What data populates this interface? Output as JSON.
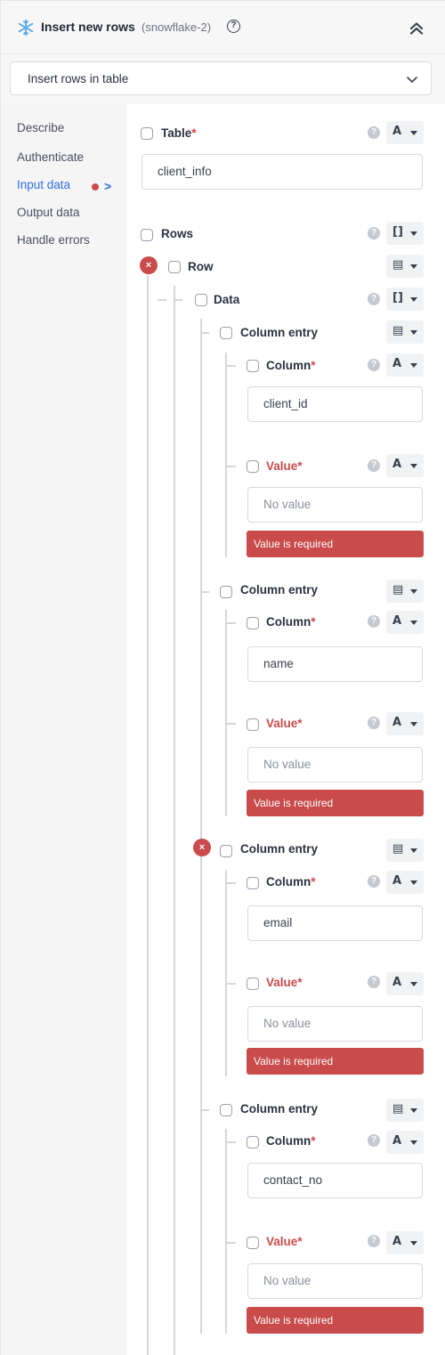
{
  "header": {
    "title": "Insert new rows",
    "connection": "(snowflake-2)",
    "help_glyph": "?"
  },
  "action": {
    "selected": "Insert rows in table"
  },
  "sidebar": {
    "items": [
      {
        "label": "Describe"
      },
      {
        "label": "Authenticate"
      },
      {
        "label": "Input data",
        "active": true,
        "has_error": true
      },
      {
        "label": "Output data"
      },
      {
        "label": "Handle errors"
      }
    ]
  },
  "form": {
    "table": {
      "label": "Table",
      "required_mark": "*",
      "value": "client_info",
      "type_glyph": "A"
    },
    "rows": {
      "label": "Rows",
      "type_glyph": "[]"
    },
    "row": {
      "label": "Row",
      "type_glyph": "▤",
      "remove_glyph": "×"
    },
    "data": {
      "label": "Data",
      "type_glyph": "[]"
    },
    "column_entries": [
      {
        "label": "Column entry",
        "column_label": "Column",
        "column_value": "client_id",
        "value_label": "Value",
        "value_placeholder": "No value",
        "error": "Value is required"
      },
      {
        "label": "Column entry",
        "column_label": "Column",
        "column_value": "name",
        "value_label": "Value",
        "value_placeholder": "No value",
        "error": "Value is required"
      },
      {
        "label": "Column entry",
        "column_label": "Column",
        "column_value": "email",
        "value_label": "Value",
        "value_placeholder": "No value",
        "error": "Value is required"
      },
      {
        "label": "Column entry",
        "column_label": "Column",
        "column_value": "contact_no",
        "value_label": "Value",
        "value_placeholder": "No value",
        "error": "Value is required"
      }
    ],
    "entry_type_glyph": "▤",
    "field_type_glyph": "A",
    "required_mark": "*",
    "help_glyph": "?",
    "remove_glyph": "×"
  },
  "colors": {
    "accent": "#2f6fde",
    "error": "#c94b4b",
    "snowflake": "#5aa9e6"
  }
}
